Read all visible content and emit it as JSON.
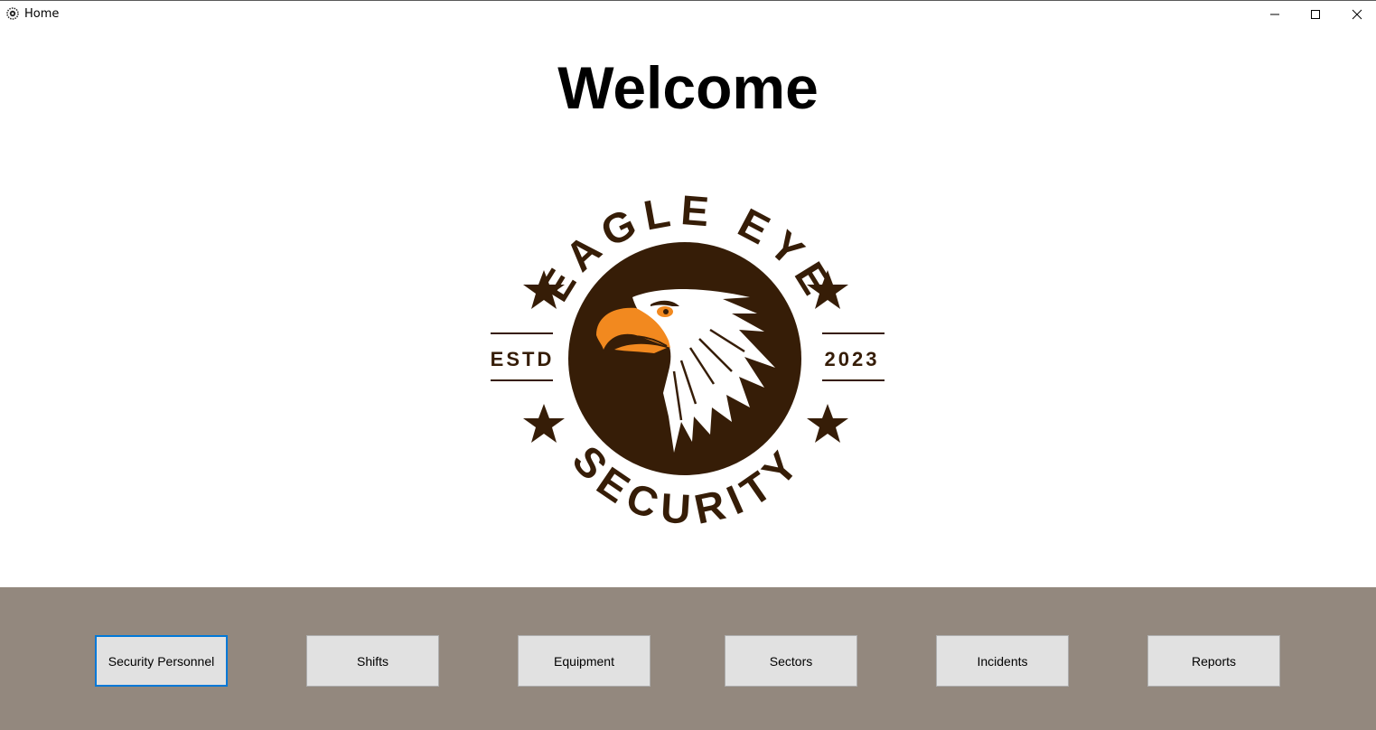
{
  "window": {
    "title": "Home"
  },
  "main": {
    "heading": "Welcome"
  },
  "logo": {
    "top_text": "EAGLE EYE",
    "bottom_text": "SECURITY",
    "left_text": "ESTD",
    "right_text": "2023",
    "colors": {
      "brown": "#361d07",
      "orange": "#f2891f",
      "white": "#ffffff"
    }
  },
  "nav": {
    "buttons": [
      {
        "label": "Security Personnel"
      },
      {
        "label": "Shifts"
      },
      {
        "label": "Equipment"
      },
      {
        "label": "Sectors"
      },
      {
        "label": "Incidents"
      },
      {
        "label": "Reports"
      }
    ]
  },
  "colors": {
    "panel_bg": "#93887e",
    "button_bg": "#e1e1e1",
    "focus_border": "#0078d7"
  }
}
